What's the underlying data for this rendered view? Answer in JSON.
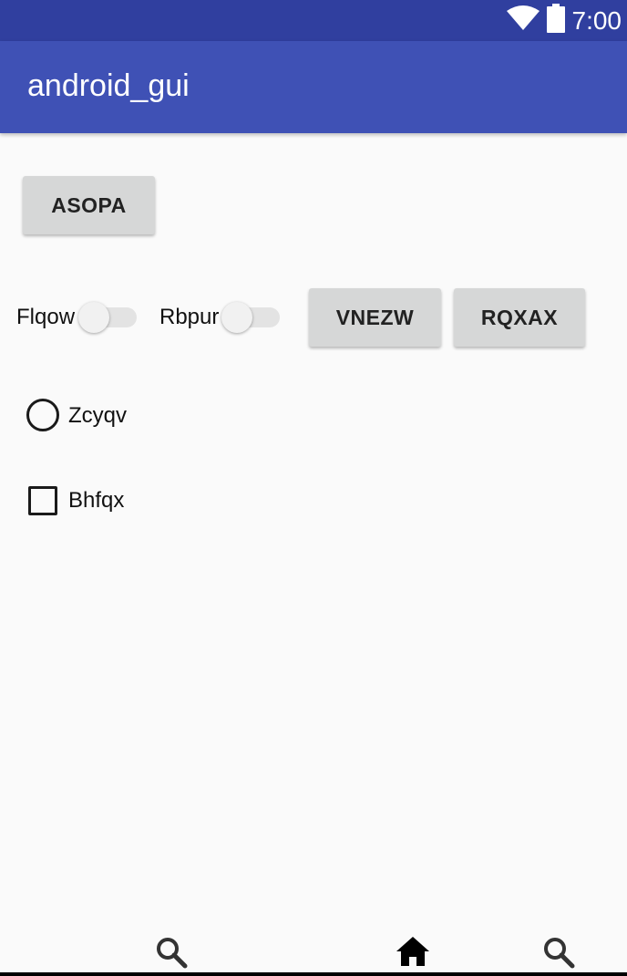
{
  "status_bar": {
    "time": "7:00",
    "icons": [
      "wifi-icon",
      "battery-icon"
    ]
  },
  "app_bar": {
    "title": "android_gui"
  },
  "buttons": {
    "asopa": "ASOPA",
    "vnezw": "VNEZW",
    "rqxax": "RQXAX"
  },
  "switches": [
    {
      "label": "Flqow",
      "checked": false
    },
    {
      "label": "Rbpur",
      "checked": false
    }
  ],
  "radio": {
    "label": "Zcyqv",
    "checked": false
  },
  "checkbox": {
    "label": "Bhfqx",
    "checked": false
  },
  "bottom_nav": {
    "icons": [
      "search-icon",
      "home-icon",
      "search-icon"
    ]
  },
  "colors": {
    "status_bar": "#303f9f",
    "app_bar": "#3f51b5",
    "background": "#fafafa",
    "button": "#d6d7d7"
  }
}
